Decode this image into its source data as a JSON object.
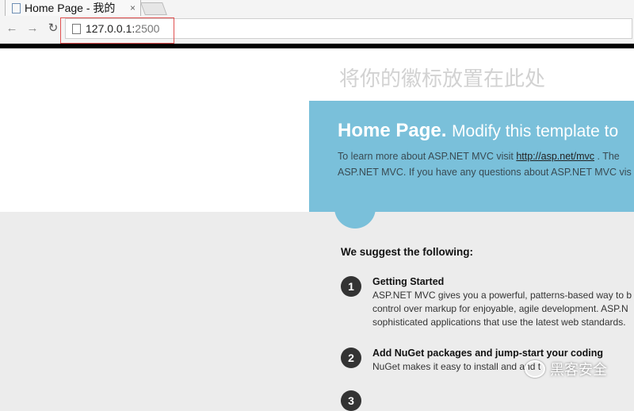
{
  "browser": {
    "tab_title": "Home Page - 我的",
    "tab_close": "×",
    "url_host": "127.0.0.1:",
    "url_port": "2500"
  },
  "page": {
    "logo_placeholder": "将你的徽标放置在此处",
    "hero": {
      "title": "Home Page.",
      "subtitle": "Modify this template to ",
      "line1_prefix": "To learn more about ASP.NET MVC visit ",
      "link": "http://asp.net/mvc",
      "line1_suffix": " . The",
      "line2": "ASP.NET MVC. If you have any questions about ASP.NET MVC vis"
    },
    "suggest_heading": "We suggest the following:",
    "steps": [
      {
        "number": "1",
        "title": "Getting Started",
        "lines": [
          "ASP.NET MVC gives you a powerful, patterns-based way to b",
          "control over markup for enjoyable, agile development. ASP.N",
          "sophisticated applications that use the latest web standards."
        ]
      },
      {
        "number": "2",
        "title": "Add NuGet packages and jump-start your coding",
        "lines": [
          "NuGet makes it easy to install and                  and t"
        ]
      },
      {
        "number": "3",
        "title": "",
        "lines": []
      }
    ],
    "watermark": "黑客安全"
  },
  "colors": {
    "hero_bg": "#7ac0da",
    "highlight_box": "#e05050"
  }
}
